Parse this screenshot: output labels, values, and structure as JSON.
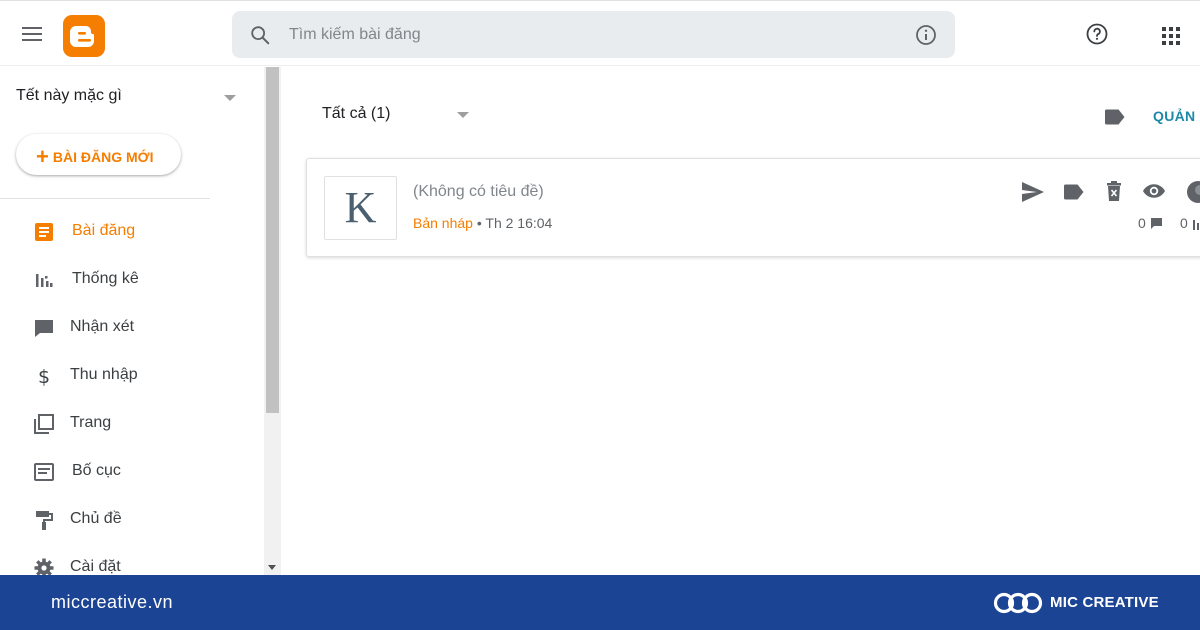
{
  "header": {
    "search_placeholder": "Tìm kiếm bài đăng"
  },
  "sidebar": {
    "blog_name": "Tết này mặc gì",
    "new_post_label": "BÀI ĐĂNG MỚI",
    "items": [
      {
        "label": "Bài đăng",
        "icon": "posts-icon",
        "active": true
      },
      {
        "label": "Thống kê",
        "icon": "stats-icon"
      },
      {
        "label": "Nhận xét",
        "icon": "comment-icon"
      },
      {
        "label": "Thu nhập",
        "icon": "dollar-icon"
      },
      {
        "label": "Trang",
        "icon": "pages-icon"
      },
      {
        "label": "Bố cục",
        "icon": "layout-icon"
      },
      {
        "label": "Chủ đề",
        "icon": "theme-paint-roller-icon"
      },
      {
        "label": "Cài đặt",
        "icon": "gear-icon"
      }
    ]
  },
  "main": {
    "filter_label": "Tất cả (1)",
    "manage_label": "QUẢN L",
    "post": {
      "thumb_letter": "K",
      "title": "(Không có tiêu đề)",
      "status": "Bản nháp",
      "separator": "•",
      "date": "Th 2 16:04",
      "comment_count": "0",
      "view_count": "0"
    }
  },
  "footer": {
    "site": "miccreative.vn",
    "brand": "MIC CREATIVE"
  },
  "colors": {
    "accent": "#f57d00",
    "footer_bg": "#1c4494",
    "manage_link": "#1e88a8"
  }
}
